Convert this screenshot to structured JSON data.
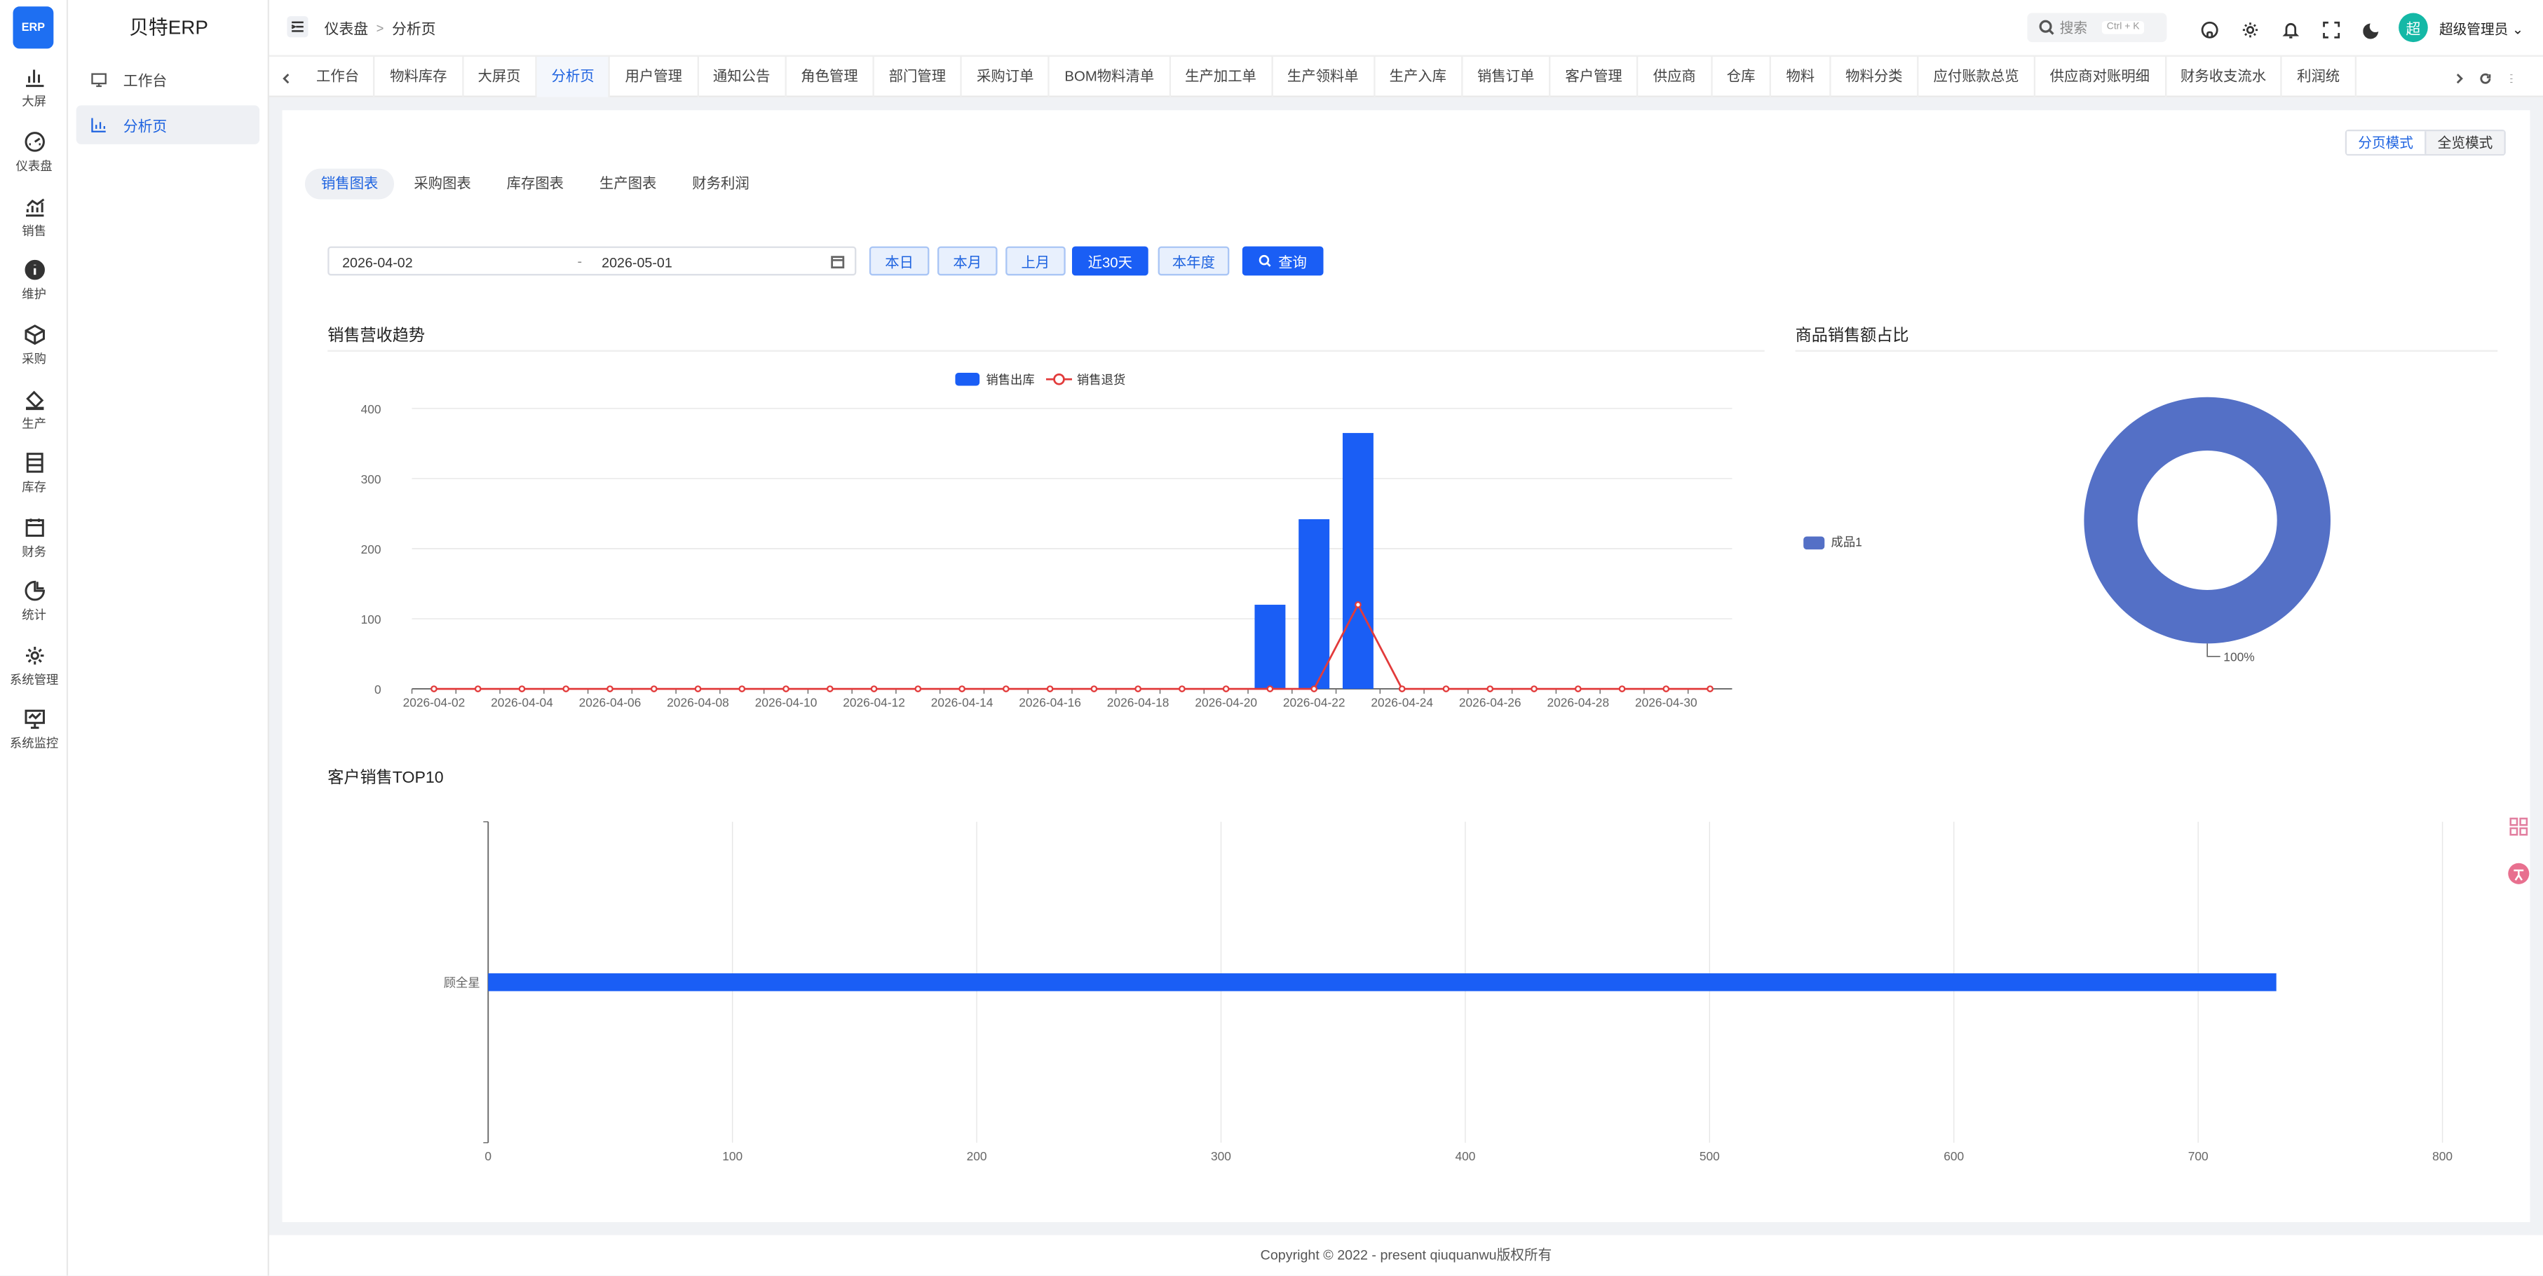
{
  "app": {
    "logo_text": "ERP",
    "brand": "贝特ERP"
  },
  "rail": [
    {
      "label": "大屏",
      "icon": "bar-chart-icon"
    },
    {
      "label": "仪表盘",
      "icon": "dashboard-icon"
    },
    {
      "label": "销售",
      "icon": "trend-chart-icon"
    },
    {
      "label": "维护",
      "icon": "info-icon"
    },
    {
      "label": "采购",
      "icon": "cube-icon"
    },
    {
      "label": "生产",
      "icon": "paint-bucket-icon"
    },
    {
      "label": "库存",
      "icon": "inventory-icon"
    },
    {
      "label": "财务",
      "icon": "calendar-icon"
    },
    {
      "label": "统计",
      "icon": "pie-chart-icon"
    },
    {
      "label": "系统管理",
      "icon": "gear-icon"
    },
    {
      "label": "系统监控",
      "icon": "monitor-icon"
    }
  ],
  "menu": [
    {
      "label": "工作台",
      "icon": "desktop-icon",
      "active": false
    },
    {
      "label": "分析页",
      "icon": "chart-icon",
      "active": true
    }
  ],
  "header": {
    "breadcrumb": [
      "仪表盘",
      "分析页"
    ],
    "search_placeholder": "搜索",
    "search_shortcut": "Ctrl + K",
    "avatar_text": "超",
    "user_name": "超级管理员"
  },
  "tabs": [
    "工作台",
    "物料库存",
    "大屏页",
    "分析页",
    "用户管理",
    "通知公告",
    "角色管理",
    "部门管理",
    "采购订单",
    "BOM物料清单",
    "生产加工单",
    "生产领料单",
    "生产入库",
    "销售订单",
    "客户管理",
    "供应商",
    "仓库",
    "物料",
    "物料分类",
    "应付账款总览",
    "供应商对账明细",
    "财务收支流水",
    "利润统"
  ],
  "active_tab": "分析页",
  "mode_switch": {
    "paged": "分页模式",
    "full": "全览模式"
  },
  "subtabs": [
    "销售图表",
    "采购图表",
    "库存图表",
    "生产图表",
    "财务利润"
  ],
  "filter": {
    "start_date": "2026-04-02",
    "end_date": "2026-05-01",
    "range_sep": "-",
    "quick": [
      "本日",
      "本月",
      "上月",
      "近30天",
      "本年度"
    ],
    "active_quick": "近30天",
    "query_label": "查询"
  },
  "sections": {
    "trend": "销售营收趋势",
    "ratio": "商品销售额占比",
    "top10": "客户销售TOP10"
  },
  "colors": {
    "primary": "#1a5ef5",
    "bar": "#1a5ef5",
    "line": "#e23b3b",
    "pie": "#5470c6"
  },
  "chart_data": [
    {
      "type": "bar",
      "title": "销售营收趋势",
      "legend": [
        "销售出库",
        "销售退货"
      ],
      "legend_position": "top-center",
      "x": [
        "2026-04-02",
        "2026-04-03",
        "2026-04-04",
        "2026-04-05",
        "2026-04-06",
        "2026-04-07",
        "2026-04-08",
        "2026-04-09",
        "2026-04-10",
        "2026-04-11",
        "2026-04-12",
        "2026-04-13",
        "2026-04-14",
        "2026-04-15",
        "2026-04-16",
        "2026-04-17",
        "2026-04-18",
        "2026-04-19",
        "2026-04-20",
        "2026-04-21",
        "2026-04-22",
        "2026-04-23",
        "2026-04-24",
        "2026-04-25",
        "2026-04-26",
        "2026-04-27",
        "2026-04-28",
        "2026-04-29",
        "2026-04-30",
        "2026-05-01"
      ],
      "x_ticks": [
        "2026-04-02",
        "2026-04-04",
        "2026-04-06",
        "2026-04-08",
        "2026-04-10",
        "2026-04-12",
        "2026-04-14",
        "2026-04-16",
        "2026-04-18",
        "2026-04-20",
        "2026-04-22",
        "2026-04-24",
        "2026-04-26",
        "2026-04-28",
        "2026-04-30"
      ],
      "series": [
        {
          "name": "销售出库",
          "type": "bar",
          "values": [
            0,
            0,
            0,
            0,
            0,
            0,
            0,
            0,
            0,
            0,
            0,
            0,
            0,
            0,
            0,
            0,
            0,
            0,
            0,
            120,
            242,
            365,
            0,
            0,
            0,
            0,
            0,
            0,
            0,
            0
          ]
        },
        {
          "name": "销售退货",
          "type": "line",
          "values": [
            0,
            0,
            0,
            0,
            0,
            0,
            0,
            0,
            0,
            0,
            0,
            0,
            0,
            0,
            0,
            0,
            0,
            0,
            0,
            0,
            0,
            120,
            0,
            0,
            0,
            0,
            0,
            0,
            0,
            0
          ]
        }
      ],
      "y_ticks": [
        0,
        100,
        200,
        300,
        400
      ],
      "ylim": [
        0,
        400
      ],
      "grid": true
    },
    {
      "type": "pie",
      "title": "商品销售额占比",
      "donut": true,
      "slices": [
        {
          "name": "成品1",
          "value": 100,
          "label": "100%"
        }
      ],
      "legend_position": "left"
    },
    {
      "type": "bar",
      "orientation": "horizontal",
      "title": "客户销售TOP10",
      "categories": [
        "顾全星"
      ],
      "values": [
        732
      ],
      "x_ticks": [
        0,
        100,
        200,
        300,
        400,
        500,
        600,
        700,
        800
      ],
      "xlim": [
        0,
        800
      ],
      "grid": true
    }
  ],
  "footer": "Copyright © 2022 - present qiuquanwu版权所有"
}
